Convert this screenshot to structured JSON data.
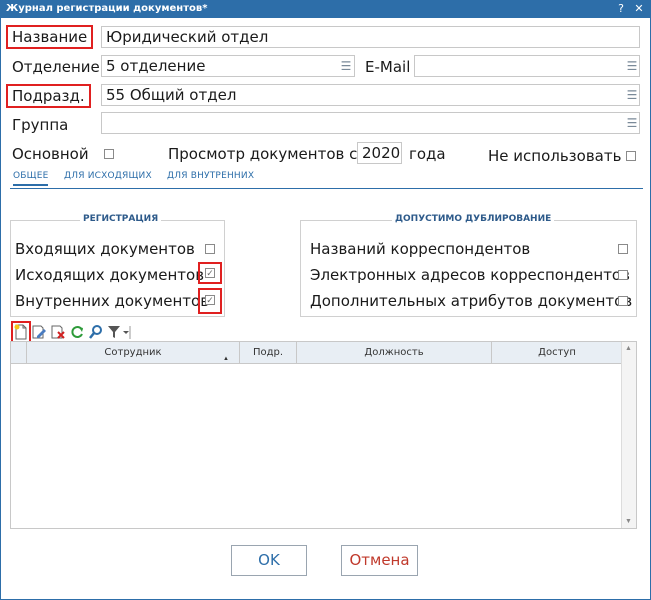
{
  "window": {
    "title": "Журнал регистрации документов*",
    "help": "?",
    "close": "✕"
  },
  "form": {
    "name_label": "Название",
    "name_value": "Юридический отдел",
    "dept_label": "Отделение",
    "dept_value": "5 отделение",
    "email_label": "E-Mail",
    "email_value": "",
    "subdiv_label": "Подразд.",
    "subdiv_value": "55 Общий отдел",
    "group_label": "Группа",
    "group_value": "",
    "main_label": "Основной",
    "main_checked": false,
    "view_label": "Просмотр документов с",
    "view_year": "2020",
    "year_suffix": "года",
    "unused_label": "Не использовать",
    "unused_checked": false
  },
  "tabs": [
    {
      "label": "ОБЩЕЕ",
      "active": true
    },
    {
      "label": "ДЛЯ ИСХОДЯЩИХ",
      "active": false
    },
    {
      "label": "ДЛЯ ВНУТРЕННИХ",
      "active": false
    }
  ],
  "registration": {
    "title": "РЕГИСТРАЦИЯ",
    "items": [
      {
        "label": "Входящих документов",
        "checked": false
      },
      {
        "label": "Исходящих документов",
        "checked": true
      },
      {
        "label": "Внутренних документов",
        "checked": true
      }
    ]
  },
  "duplication": {
    "title": "ДОПУСТИМО ДУБЛИРОВАНИЕ",
    "items": [
      {
        "label": "Названий корреспондентов",
        "checked": false
      },
      {
        "label": "Электронных адресов корреспондентов",
        "checked": false
      },
      {
        "label": "Дополнительных атрибутов документов",
        "checked": false
      }
    ]
  },
  "toolbar": {
    "icons": [
      "add-icon",
      "edit-icon",
      "delete-icon",
      "refresh-icon",
      "search-icon",
      "filter-icon"
    ]
  },
  "table": {
    "columns": [
      "Сотрудник",
      "Подр.",
      "Должность",
      "Доступ"
    ],
    "rows": []
  },
  "buttons": {
    "ok": "OK",
    "cancel": "Отмена"
  },
  "colors": {
    "accent": "#2d6ea9",
    "highlight": "#e02020",
    "cancel_text": "#c0392b"
  }
}
